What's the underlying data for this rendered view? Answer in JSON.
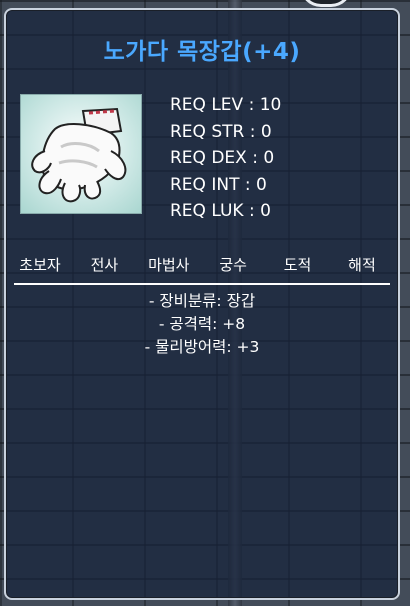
{
  "item": {
    "name": "노가다 목장갑(+4)",
    "icon": "white-work-glove-icon",
    "name_color": "#4aa8ff"
  },
  "requirements": [
    "REQ LEV : 10",
    "REQ STR : 0",
    "REQ DEX : 0",
    "REQ INT : 0",
    "REQ LUK : 0"
  ],
  "jobs": [
    "초보자",
    "전사",
    "마법사",
    "궁수",
    "도적",
    "해적"
  ],
  "stats": [
    "- 장비분류: 장갑",
    "- 공격력: +8",
    "- 물리방어력: +3"
  ]
}
